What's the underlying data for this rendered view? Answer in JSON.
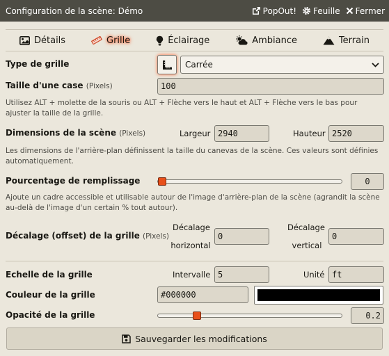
{
  "header": {
    "title": "Configuration de la scène: Démo",
    "popout": "PopOut!",
    "sheet": "Feuille",
    "close": "Fermer"
  },
  "tabs": [
    {
      "label": "Détails",
      "icon": "image-icon",
      "active": false
    },
    {
      "label": "Grille",
      "icon": "ruler-icon",
      "active": true
    },
    {
      "label": "Éclairage",
      "icon": "lightbulb-icon",
      "active": false
    },
    {
      "label": "Ambiance",
      "icon": "cloud-sun-icon",
      "active": false
    },
    {
      "label": "Terrain",
      "icon": "mountain-icon",
      "active": false
    }
  ],
  "grid_type": {
    "label": "Type de grille",
    "value": "Carrée"
  },
  "grid_size": {
    "label": "Taille d'une case",
    "units": "(Pixels)",
    "value": "100",
    "hint": "Utilisez ALT + molette de la souris ou ALT + Flèche vers le haut et ALT + Flèche vers le bas pour ajuster la taille de la grille."
  },
  "dimensions": {
    "label": "Dimensions de la scène",
    "units": "(Pixels)",
    "width_label": "Largeur",
    "width": "2940",
    "height_label": "Hauteur",
    "height": "2520",
    "hint": "Les dimensions de l'arrière-plan définissent la taille du canevas de la scène. Ces valeurs sont définies automatiquement."
  },
  "padding": {
    "label": "Pourcentage de remplissage",
    "value": "0",
    "fraction": 0.0,
    "hint": "Ajoute un cadre accessible et utilisable autour de l'image d'arrière-plan de la scène (agrandit la scène au-delà de l'image d'un certain % tout autour)."
  },
  "offset": {
    "label": "Décalage (offset) de la grille",
    "units": "(Pixels)",
    "h_label_1": "Décalage",
    "h_label_2": "horizontal",
    "h_value": "0",
    "v_label_1": "Décalage",
    "v_label_2": "vertical",
    "v_value": "0"
  },
  "scale": {
    "label": "Echelle de la grille",
    "interval_label": "Intervalle",
    "interval": "5",
    "unit_label": "Unité",
    "unit": "ft"
  },
  "color": {
    "label": "Couleur de la grille",
    "value": "#000000",
    "swatch": "#000000"
  },
  "opacity": {
    "label": "Opacité de la grille",
    "value": "0.2",
    "fraction": 0.2
  },
  "save": {
    "label": "Sauvegarder les modifications"
  },
  "colors": {
    "header_bg": "#4d4c44",
    "accent": "#e8501a",
    "background": "#ebe7dc"
  }
}
